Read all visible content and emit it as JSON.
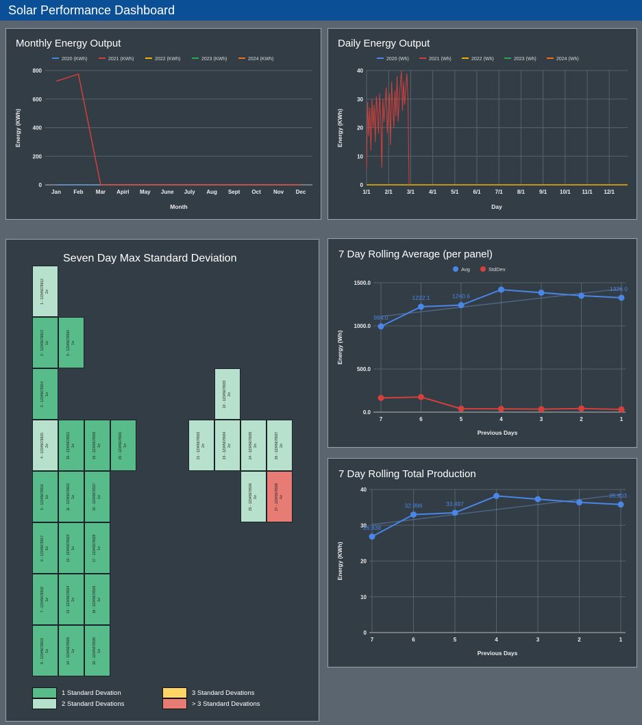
{
  "header": {
    "title": "Solar Performance Dashboard"
  },
  "monthly": {
    "title": "Monthly Energy Output",
    "chart_data": {
      "type": "line",
      "title": "Monthly Energy Output",
      "xlabel": "Month",
      "ylabel": "Energy (KWh)",
      "categories": [
        "Jan",
        "Feb",
        "Mar",
        "Apirl",
        "May",
        "June",
        "July",
        "Aug",
        "Sept",
        "Oct",
        "Nov",
        "Dec"
      ],
      "yticks": [
        "0",
        "200",
        "400",
        "600",
        "800"
      ],
      "ylim": [
        0,
        800
      ],
      "legend_position": "top",
      "series": [
        {
          "name": "2020 (KWh)",
          "color": "#4a86e8",
          "values": [
            0,
            0,
            0,
            0,
            0,
            0,
            0,
            0,
            0,
            0,
            0,
            0
          ]
        },
        {
          "name": "2021 (KWh)",
          "color": "#d6403a",
          "values": [
            725,
            775,
            0,
            0,
            0,
            0,
            0,
            0,
            0,
            0,
            0,
            0
          ]
        },
        {
          "name": "2022 (KWh)",
          "color": "#f0b400",
          "values": [
            0,
            0,
            0,
            0,
            0,
            0,
            0,
            0,
            0,
            0,
            0,
            0
          ]
        },
        {
          "name": "2023 (KWh)",
          "color": "#2ea84e",
          "values": [
            0,
            0,
            0,
            0,
            0,
            0,
            0,
            0,
            0,
            0,
            0,
            0
          ]
        },
        {
          "name": "2024 (KWh)",
          "color": "#f07020",
          "values": [
            0,
            0,
            0,
            0,
            0,
            0,
            0,
            0,
            0,
            0,
            0,
            0
          ]
        }
      ]
    }
  },
  "daily": {
    "title": "Daily Energy Output",
    "chart_data": {
      "type": "line",
      "title": "Daily Energy Output",
      "xlabel": "Day",
      "ylabel": "Energy (KWh)",
      "xticks": [
        "1/1",
        "2/1",
        "3/1",
        "4/1",
        "5/1",
        "6/1",
        "7/1",
        "8/1",
        "9/1",
        "10/1",
        "11/1",
        "12/1"
      ],
      "yticks": [
        "0",
        "10",
        "20",
        "30",
        "40"
      ],
      "ylim": [
        0,
        40
      ],
      "legend_position": "top",
      "series": [
        {
          "name": "2020 (Wh)",
          "color": "#4a86e8"
        },
        {
          "name": "2021 (Wh)",
          "color": "#d6403a",
          "values": [
            6,
            29,
            17,
            27,
            12,
            30,
            20,
            28,
            15,
            31,
            26,
            18,
            32,
            24,
            6,
            30,
            22,
            28,
            34,
            18,
            26,
            32,
            14,
            36,
            28,
            20,
            33,
            24,
            38,
            22,
            30,
            35,
            40,
            26,
            36,
            28,
            34,
            39,
            30,
            0
          ]
        },
        {
          "name": "2022 (Wh)",
          "color": "#f0b400"
        },
        {
          "name": "2023 (Wh)",
          "color": "#2ea84e"
        },
        {
          "name": "2024 (Wh)",
          "color": "#f07020"
        }
      ]
    }
  },
  "heatmap": {
    "title": "Seven Day Max Standard Deviation",
    "colors": {
      "1": "#57bb8a",
      "2": "#b7e1cd",
      "3": "#ffd666",
      "4": "#e67c73"
    },
    "cells": [
      {
        "label": "1 - 12345678912",
        "sigma": "2σ",
        "level": 2
      },
      {
        "label": "2 - 12345678913",
        "sigma": "1σ",
        "level": 1
      },
      {
        "label": "3 - 12345678914",
        "sigma": "1σ",
        "level": 1
      },
      {
        "label": "4 - 12345678915",
        "sigma": "2σ",
        "level": 2
      },
      {
        "label": "5 - 12345678916",
        "sigma": "1σ",
        "level": 1
      },
      {
        "label": "6 - 12345678917",
        "sigma": "1σ",
        "level": 1
      },
      {
        "label": "7 - 12345678918",
        "sigma": "1σ",
        "level": 1
      },
      {
        "label": "8 - 12345678919",
        "sigma": "1σ",
        "level": 1
      },
      {
        "label": "9 - 12345678920",
        "sigma": "1σ",
        "level": 1
      },
      {
        "label": "10 - 12345678921",
        "sigma": "1σ",
        "level": 1
      },
      {
        "label": "11 - 12345678922",
        "sigma": "1σ",
        "level": 1
      },
      {
        "label": "12 - 12345678923",
        "sigma": "1σ",
        "level": 1
      },
      {
        "label": "13 - 12345678924",
        "sigma": "1σ",
        "level": 1
      },
      {
        "label": "14 - 12345678925",
        "sigma": "1σ",
        "level": 1
      },
      {
        "label": "15 - 12345678926",
        "sigma": "1σ",
        "level": 1
      },
      {
        "label": "16 - 12345678927",
        "sigma": "1σ",
        "level": 1
      },
      {
        "label": "17 - 12345678928",
        "sigma": "1σ",
        "level": 1
      },
      {
        "label": "18 - 12345678929",
        "sigma": "1σ",
        "level": 1
      },
      {
        "label": "19 - 12345678930",
        "sigma": "1σ",
        "level": 1
      },
      {
        "label": "20 - 12345678931",
        "sigma": "1σ",
        "level": 1
      },
      {
        "label": "21 - 12345678932",
        "sigma": "2σ",
        "level": 2
      },
      {
        "label": "22 - 12345678933",
        "sigma": "2σ",
        "level": 2
      },
      {
        "label": "23 - 12345678934",
        "sigma": "2σ",
        "level": 2
      },
      {
        "label": "24 - 12345678935",
        "sigma": "2σ",
        "level": 2
      },
      {
        "label": "25 - 12345678936",
        "sigma": "2σ",
        "level": 2
      },
      {
        "label": "26 - 12345678937",
        "sigma": "2σ",
        "level": 2
      },
      {
        "label": "27 - 12345678938",
        "sigma": "4σ",
        "level": 4
      }
    ],
    "legend": [
      {
        "label": "1 Standard Devation",
        "level": 1
      },
      {
        "label": "2 Standard Devations",
        "level": 2
      },
      {
        "label": "3 Standard Devations",
        "level": 3
      },
      {
        "label": "> 3 Standard Devations",
        "level": 4
      }
    ]
  },
  "rolling_avg": {
    "title": "7 Day Rolling Average (per panel)",
    "chart_data": {
      "type": "line",
      "title": "7 Day Rolling Average (per panel)",
      "xlabel": "Previous Days",
      "ylabel": "Energy (Wh)",
      "categories": [
        "7",
        "6",
        "5",
        "4",
        "3",
        "2",
        "1"
      ],
      "yticks": [
        "0.0",
        "500.0",
        "1000.0",
        "1500.0"
      ],
      "ylim": [
        0,
        1500
      ],
      "legend_position": "top",
      "series": [
        {
          "name": "Avg",
          "color": "#4a86e8",
          "values": [
            994.0,
            1222.1,
            1240.6,
            1420,
            1385,
            1350,
            1326.0
          ],
          "labels": [
            "994.0",
            "1222.1",
            "1240.6",
            "",
            "",
            "",
            "1326.0"
          ]
        },
        {
          "name": "StdDev",
          "color": "#d6403a",
          "values": [
            165,
            175,
            40,
            38,
            35,
            42,
            32
          ]
        }
      ],
      "trendline": [
        1110,
        1430
      ]
    }
  },
  "rolling_total": {
    "title": "7 Day Rolling Total Production",
    "chart_data": {
      "type": "line",
      "title": "7 Day Rolling Total Production",
      "xlabel": "Previous Days",
      "ylabel": "Energy (KWh)",
      "categories": [
        "7",
        "6",
        "5",
        "4",
        "3",
        "2",
        "1"
      ],
      "yticks": [
        "0",
        "10",
        "20",
        "30",
        "40"
      ],
      "ylim": [
        0,
        40
      ],
      "series": [
        {
          "name": "Total",
          "color": "#4a86e8",
          "values": [
            26.838,
            32.996,
            33.497,
            38.2,
            37.3,
            36.4,
            35.803
          ],
          "labels": [
            "26.838",
            "32.996",
            "33.497",
            "",
            "",
            "",
            "35.803"
          ]
        }
      ],
      "trendline": [
        30.2,
        38.6
      ]
    }
  }
}
